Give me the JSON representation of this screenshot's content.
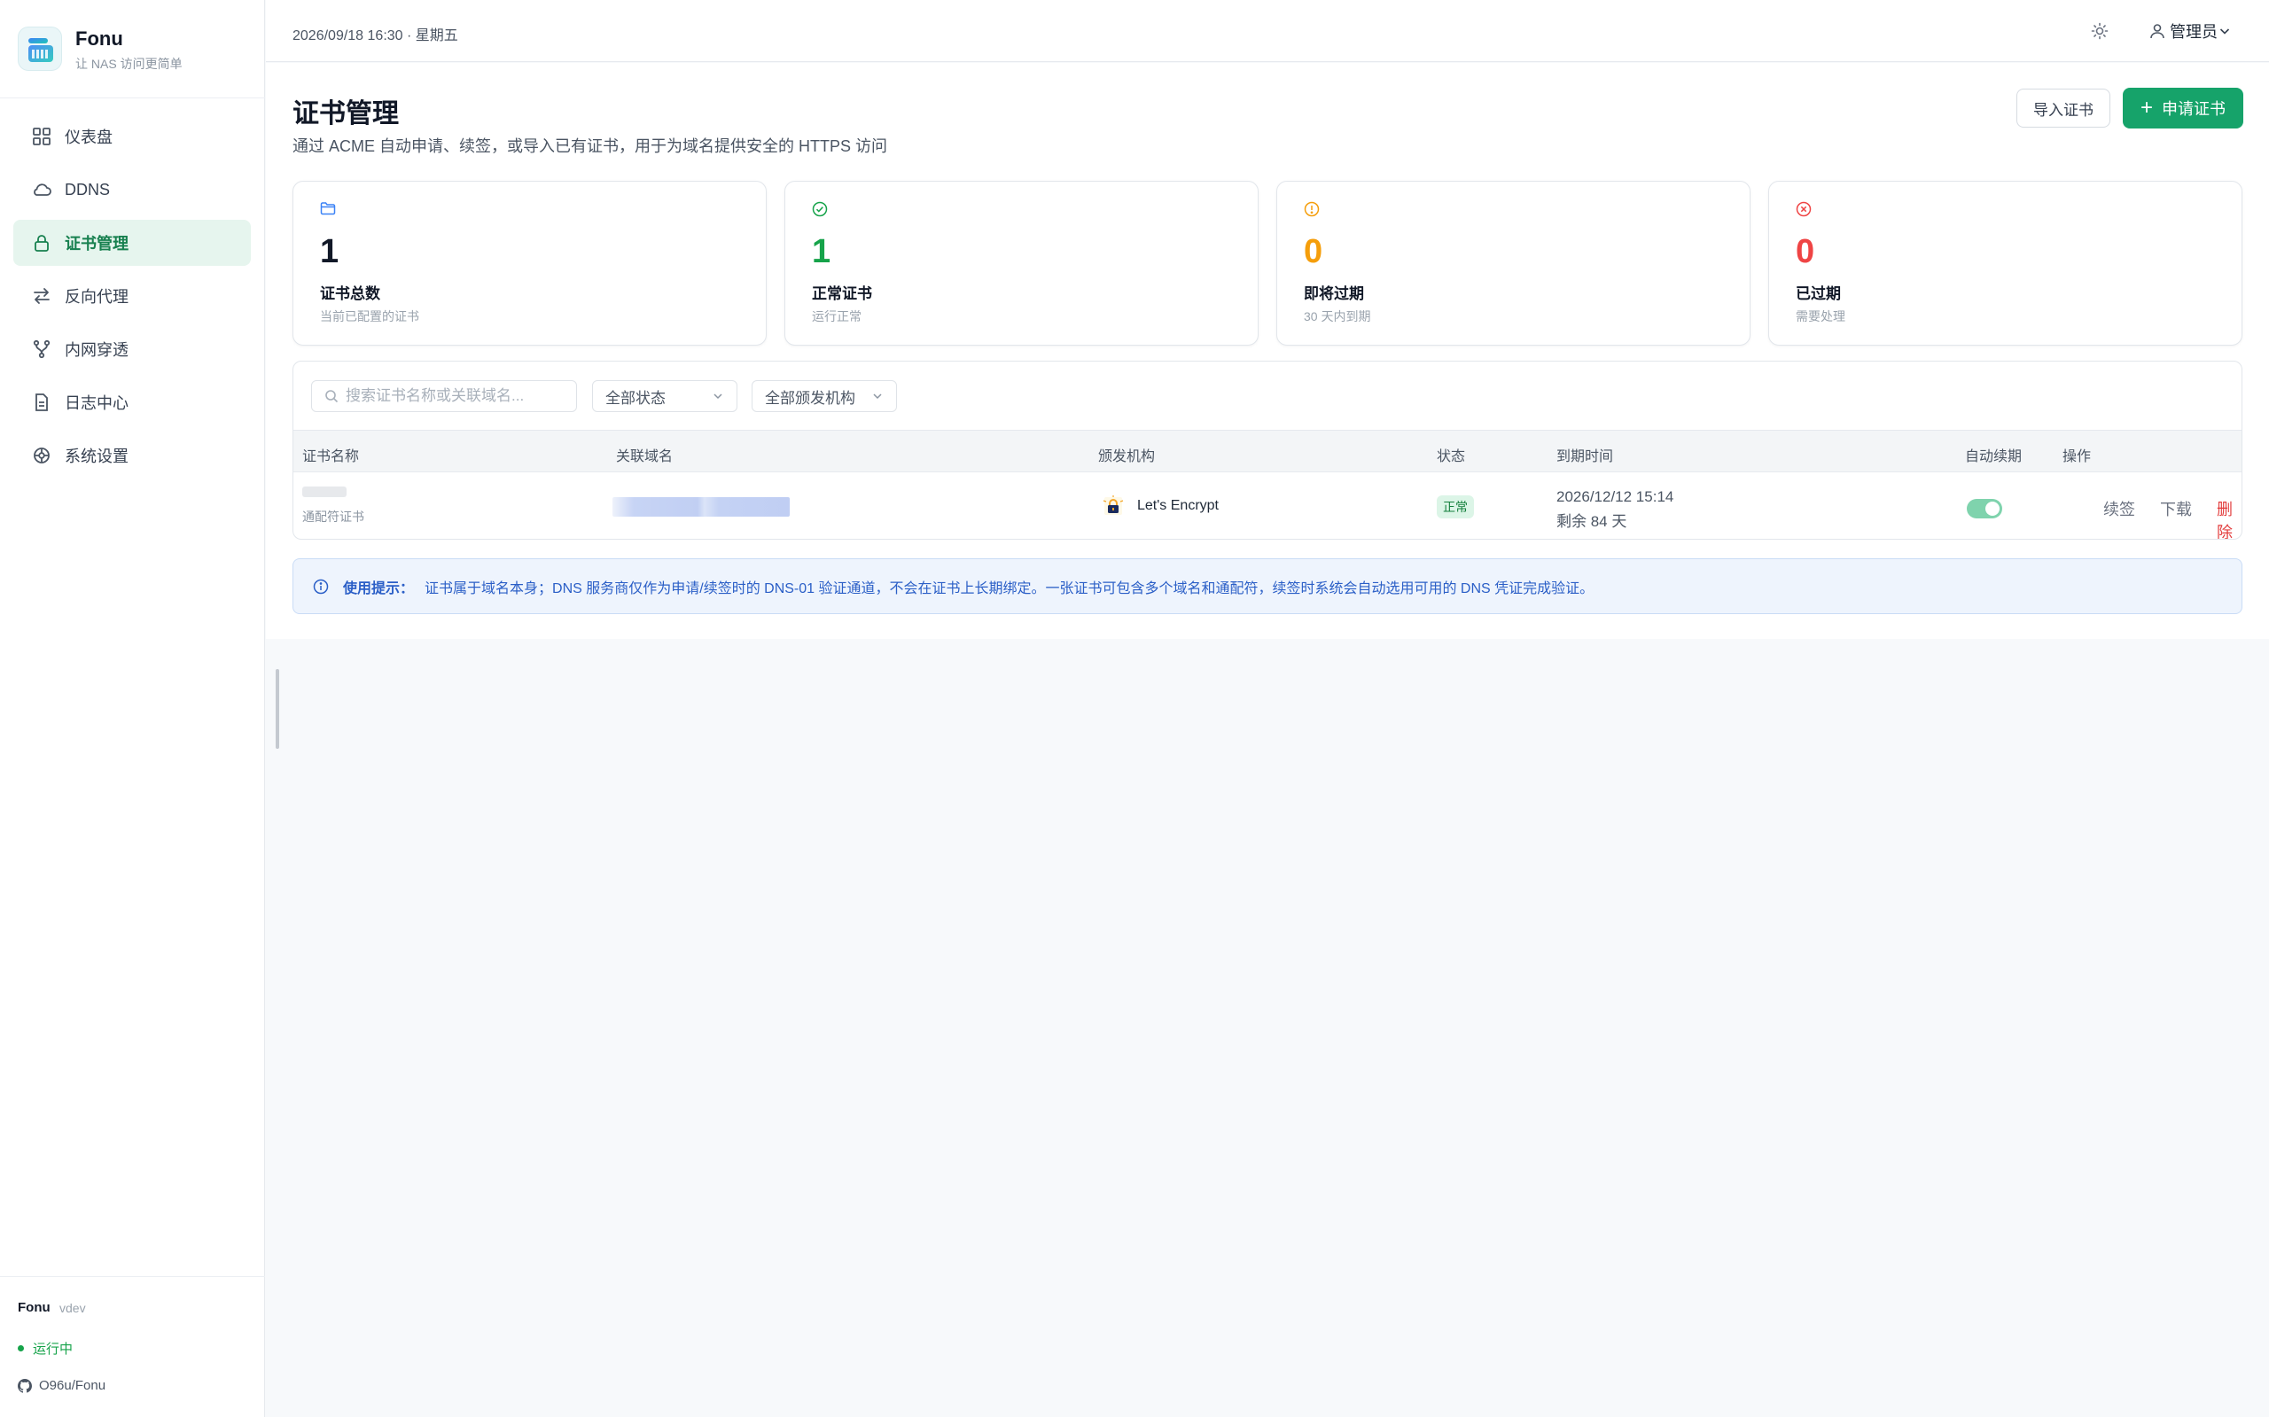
{
  "brand": {
    "name": "Fonu",
    "tagline": "让 NAS 访问更简单"
  },
  "sidebar": {
    "items": [
      {
        "label": "仪表盘",
        "icon": "dashboard-icon",
        "active": false
      },
      {
        "label": "DDNS",
        "icon": "cloud-icon",
        "active": false
      },
      {
        "label": "证书管理",
        "icon": "lock-icon",
        "active": true
      },
      {
        "label": "反向代理",
        "icon": "swap-arrows-icon",
        "active": false
      },
      {
        "label": "内网穿透",
        "icon": "branch-icon",
        "active": false
      },
      {
        "label": "日志中心",
        "icon": "document-icon",
        "active": false
      },
      {
        "label": "系统设置",
        "icon": "settings-icon",
        "active": false
      }
    ],
    "footer": {
      "app": "Fonu",
      "version": "vdev",
      "status": "运行中",
      "repo": "O96u/Fonu"
    }
  },
  "topbar": {
    "datetime": "2026/09/18 16:30 · 星期五",
    "user": "管理员"
  },
  "page": {
    "title": "证书管理",
    "description": "通过 ACME 自动申请、续签，或导入已有证书，用于为域名提供安全的 HTTPS 访问",
    "import_button": "导入证书",
    "apply_button": "申请证书"
  },
  "stats": [
    {
      "value": "1",
      "label": "证书总数",
      "sub": "当前已配置的证书",
      "color": "#111827",
      "icon": "folder-icon",
      "icon_color": "#3b82f6"
    },
    {
      "value": "1",
      "label": "正常证书",
      "sub": "运行正常",
      "color": "#16a34a",
      "icon": "check-circle-icon",
      "icon_color": "#16a34a"
    },
    {
      "value": "0",
      "label": "即将过期",
      "sub": "30 天内到期",
      "color": "#f59e0b",
      "icon": "warning-circle-icon",
      "icon_color": "#f59e0b"
    },
    {
      "value": "0",
      "label": "已过期",
      "sub": "需要处理",
      "color": "#ef4444",
      "icon": "x-circle-icon",
      "icon_color": "#ef4444"
    }
  ],
  "filters": {
    "search_placeholder": "搜索证书名称或关联域名...",
    "status_select": "全部状态",
    "issuer_select": "全部颁发机构"
  },
  "table": {
    "headers": [
      "证书名称",
      "关联域名",
      "颁发机构",
      "状态",
      "到期时间",
      "自动续期",
      "操作"
    ],
    "rows": [
      {
        "name": "",
        "type": "通配符证书",
        "domain": "",
        "issuer": "Let's Encrypt",
        "status": "正常",
        "expiry_date": "2026/12/12 15:14",
        "remaining": "剩余 84 天",
        "auto_renew": true,
        "actions": {
          "renew": "续签",
          "download": "下载",
          "delete": "删除"
        }
      }
    ]
  },
  "tip": {
    "title": "使用提示：",
    "text": "证书属于域名本身；DNS 服务商仅作为申请/续签时的 DNS-01 验证通道，不会在证书上长期绑定。一张证书可包含多个域名和通配符，续签时系统会自动选用可用的 DNS 凭证完成验证。"
  },
  "colors": {
    "accent": "#16a36a",
    "active_bg": "#e6f5ee",
    "danger": "#e23c3c",
    "tip_text": "#2b5fc7"
  }
}
